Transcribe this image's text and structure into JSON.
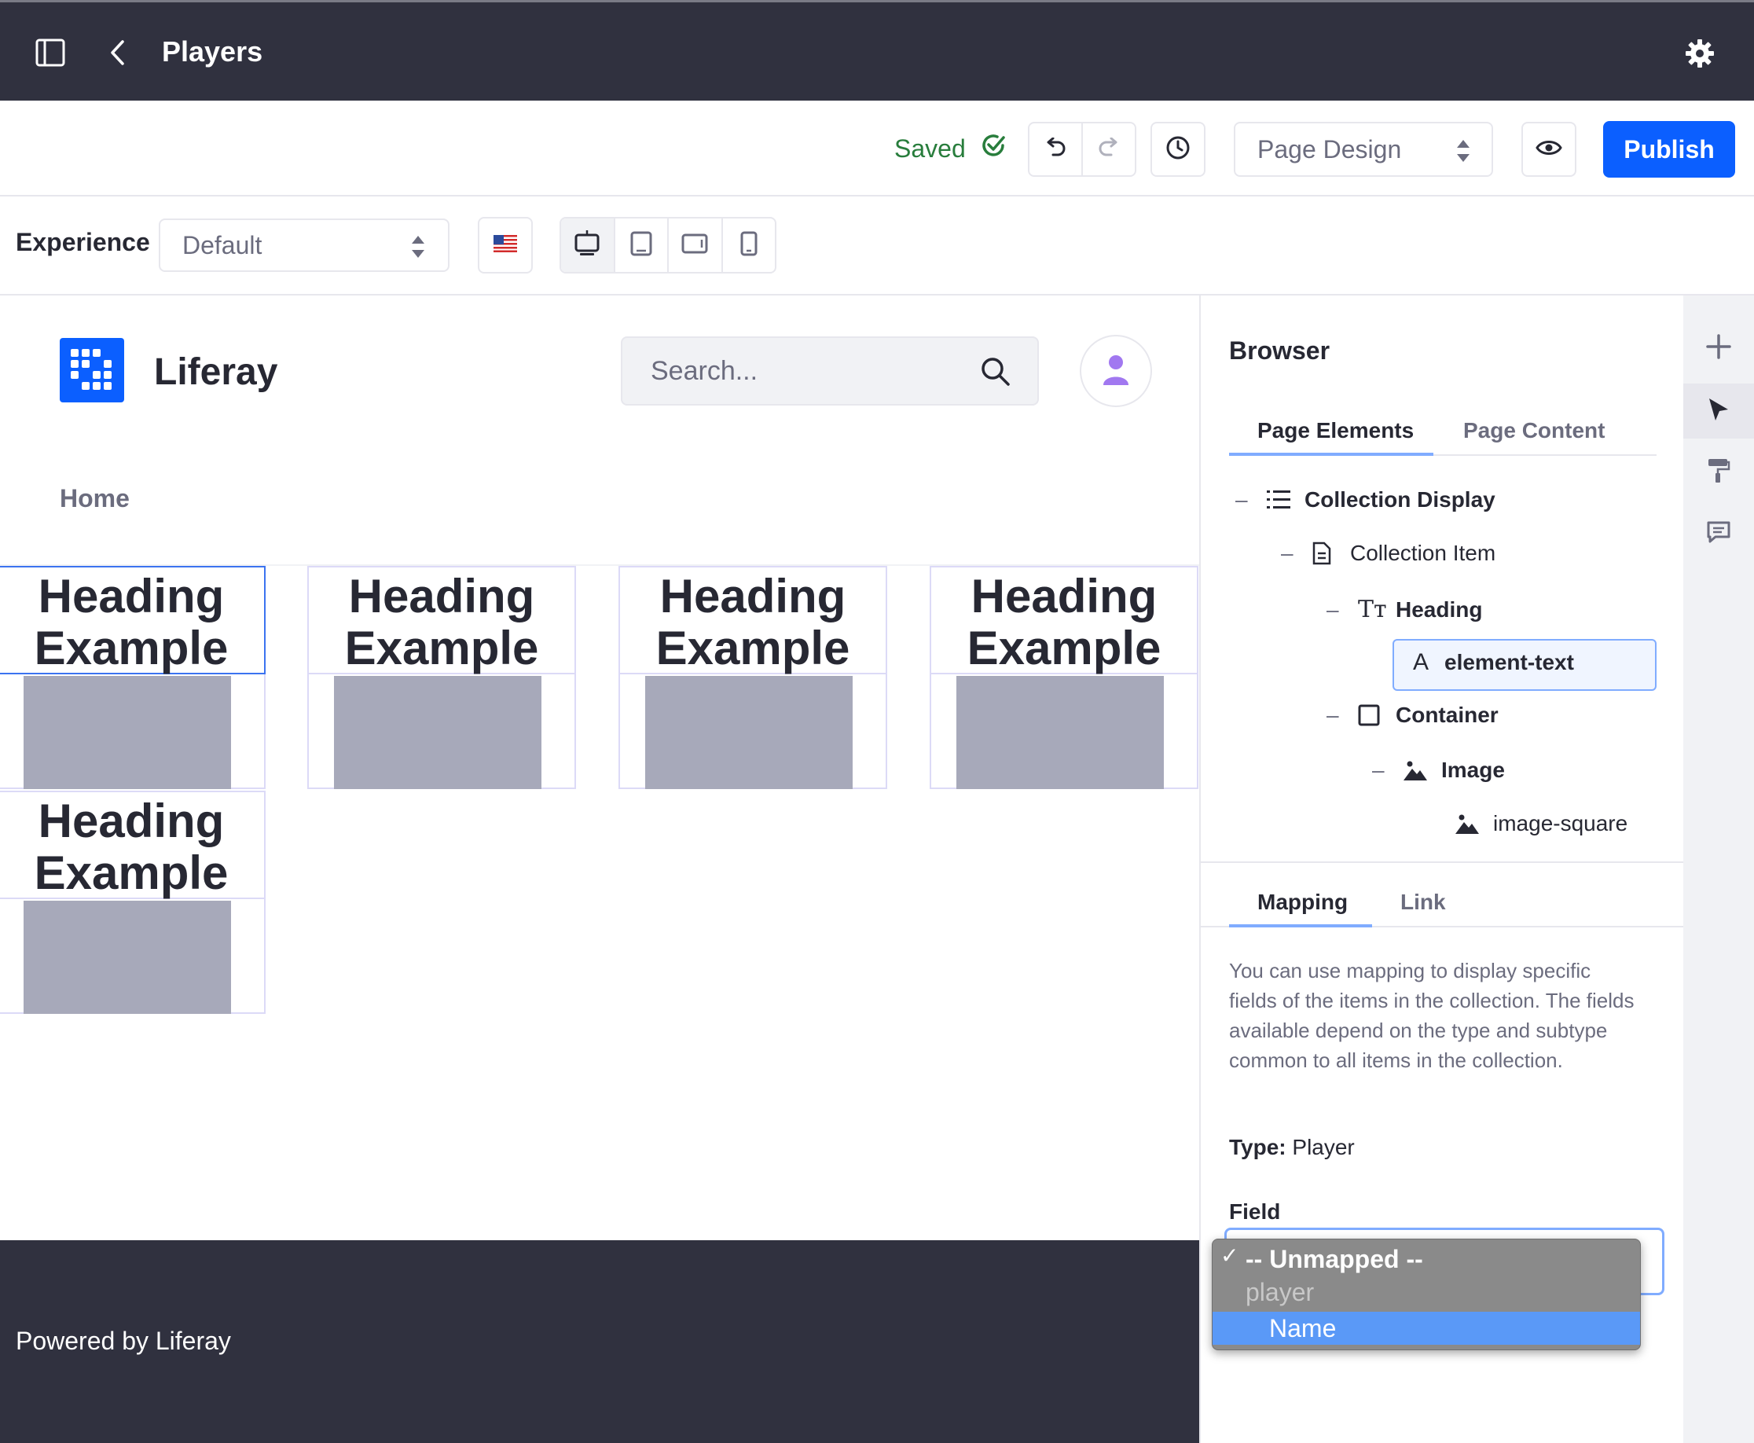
{
  "topbar": {
    "title": "Players"
  },
  "toolbar": {
    "saved_label": "Saved",
    "mode_select": "Page Design",
    "publish_label": "Publish"
  },
  "experience": {
    "label": "Experience",
    "selected": "Default"
  },
  "site": {
    "name": "Liferay",
    "search_placeholder": "Search...",
    "nav": [
      "Home"
    ]
  },
  "collection": {
    "items": [
      {
        "heading": "Heading Example"
      },
      {
        "heading": "Heading Example"
      },
      {
        "heading": "Heading Example"
      },
      {
        "heading": "Heading Example"
      },
      {
        "heading": "Heading Example"
      }
    ]
  },
  "footer": {
    "text": "Powered by Liferay"
  },
  "browser": {
    "title": "Browser",
    "tabs": [
      "Page Elements",
      "Page Content"
    ],
    "tree": [
      {
        "label": "Collection Display",
        "icon": "list-icon",
        "bold": true
      },
      {
        "label": "Collection Item",
        "icon": "document-icon",
        "bold": false
      },
      {
        "label": "Heading",
        "icon": "text-icon",
        "bold": true
      },
      {
        "label": "element-text",
        "icon": "text-a-icon",
        "bold": true
      },
      {
        "label": "Container",
        "icon": "square-icon",
        "bold": true
      },
      {
        "label": "Image",
        "icon": "image-icon",
        "bold": true
      },
      {
        "label": "image-square",
        "icon": "image-icon",
        "bold": false
      }
    ],
    "config_tabs": [
      "Mapping",
      "Link"
    ],
    "mapping_description": "You can use mapping to display specific fields of the items in the collection. The fields available depend on the type and subtype common to all items in the collection.",
    "type_label": "Type:",
    "type_value": "Player",
    "field_label": "Field"
  },
  "field_dropdown": {
    "options": [
      "-- Unmapped --",
      "player",
      "Name"
    ],
    "selected": "-- Unmapped --",
    "highlighted": "Name"
  },
  "colors": {
    "primary": "#0b5fff",
    "dark_bar": "#30313f",
    "saved_green": "#287d3c"
  }
}
